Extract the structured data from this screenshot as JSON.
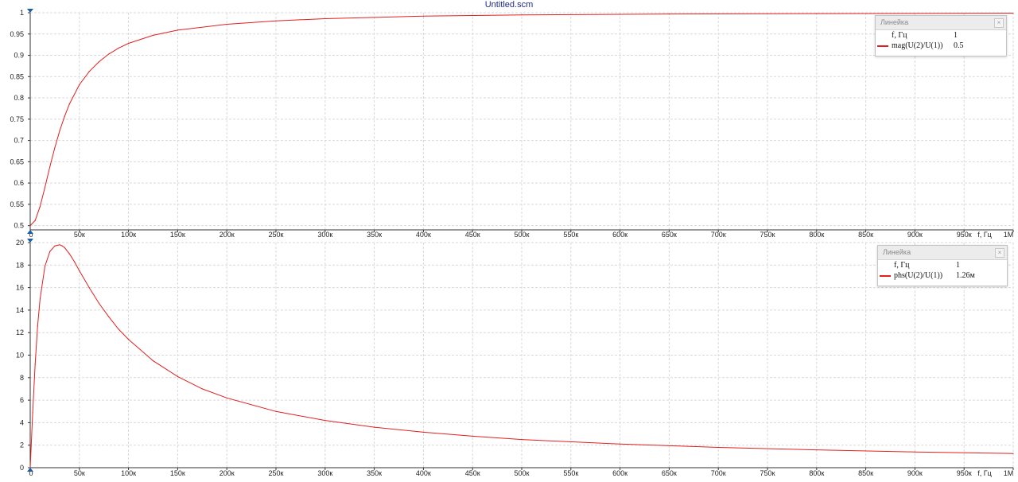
{
  "window": {
    "title": "Untitled.scm"
  },
  "colors": {
    "trace": "#e02020",
    "grid": "#d9d9d9",
    "axis": "#333333",
    "marker": "#1a5ca8"
  },
  "rulers": [
    {
      "title": "Линейка",
      "close": "×",
      "rows": [
        {
          "name": "f, Гц",
          "value": "1",
          "swatch": false
        },
        {
          "name": "mag(U(2)/U(1))",
          "value": "0.5",
          "swatch": true
        }
      ]
    },
    {
      "title": "Линейка",
      "close": "×",
      "rows": [
        {
          "name": "f, Гц",
          "value": "1",
          "swatch": false
        },
        {
          "name": "phs(U(2)/U(1))",
          "value": "1.26м",
          "swatch": true
        }
      ]
    }
  ],
  "chart_data": [
    {
      "type": "line",
      "xlabel": "f, Гц",
      "ylabel": "",
      "xlim": [
        0,
        1000000
      ],
      "ylim": [
        0.49,
        1.0
      ],
      "grid": true,
      "x_ticks": [
        {
          "v": 0,
          "label": "0"
        },
        {
          "v": 50000,
          "label": "50к"
        },
        {
          "v": 100000,
          "label": "100к"
        },
        {
          "v": 150000,
          "label": "150к"
        },
        {
          "v": 200000,
          "label": "200к"
        },
        {
          "v": 250000,
          "label": "250к"
        },
        {
          "v": 300000,
          "label": "300к"
        },
        {
          "v": 350000,
          "label": "350к"
        },
        {
          "v": 400000,
          "label": "400к"
        },
        {
          "v": 450000,
          "label": "450к"
        },
        {
          "v": 500000,
          "label": "500к"
        },
        {
          "v": 550000,
          "label": "550к"
        },
        {
          "v": 600000,
          "label": "600к"
        },
        {
          "v": 650000,
          "label": "650к"
        },
        {
          "v": 700000,
          "label": "700к"
        },
        {
          "v": 750000,
          "label": "750к"
        },
        {
          "v": 800000,
          "label": "800к"
        },
        {
          "v": 850000,
          "label": "850к"
        },
        {
          "v": 900000,
          "label": "900к"
        },
        {
          "v": 950000,
          "label": "950к"
        },
        {
          "v": 1000000,
          "label": "1М"
        }
      ],
      "y_ticks": [
        {
          "v": 0.5,
          "label": "0.5"
        },
        {
          "v": 0.55,
          "label": "0.55"
        },
        {
          "v": 0.6,
          "label": "0.6"
        },
        {
          "v": 0.65,
          "label": "0.65"
        },
        {
          "v": 0.7,
          "label": "0.7"
        },
        {
          "v": 0.75,
          "label": "0.75"
        },
        {
          "v": 0.8,
          "label": "0.8"
        },
        {
          "v": 0.85,
          "label": "0.85"
        },
        {
          "v": 0.9,
          "label": "0.9"
        },
        {
          "v": 0.95,
          "label": "0.95"
        },
        {
          "v": 1.0,
          "label": "1"
        }
      ],
      "series": [
        {
          "name": "mag(U(2)/U(1))",
          "color": "#e02020",
          "x": [
            0,
            5000,
            10000,
            15000,
            20000,
            25000,
            30000,
            35000,
            40000,
            50000,
            60000,
            70000,
            80000,
            90000,
            100000,
            125000,
            150000,
            200000,
            250000,
            300000,
            400000,
            500000,
            650000,
            800000,
            1000000
          ],
          "y": [
            0.5,
            0.512,
            0.545,
            0.59,
            0.638,
            0.683,
            0.723,
            0.757,
            0.786,
            0.831,
            0.862,
            0.885,
            0.903,
            0.917,
            0.928,
            0.947,
            0.959,
            0.973,
            0.981,
            0.986,
            0.992,
            0.995,
            0.997,
            0.998,
            0.999
          ]
        }
      ]
    },
    {
      "type": "line",
      "xlabel": "f, Гц",
      "ylabel": "",
      "xlim": [
        0,
        1000000
      ],
      "ylim": [
        0,
        20
      ],
      "grid": true,
      "x_ticks": [
        {
          "v": 0,
          "label": "0"
        },
        {
          "v": 50000,
          "label": "50к"
        },
        {
          "v": 100000,
          "label": "100к"
        },
        {
          "v": 150000,
          "label": "150к"
        },
        {
          "v": 200000,
          "label": "200к"
        },
        {
          "v": 250000,
          "label": "250к"
        },
        {
          "v": 300000,
          "label": "300к"
        },
        {
          "v": 350000,
          "label": "350к"
        },
        {
          "v": 400000,
          "label": "400к"
        },
        {
          "v": 450000,
          "label": "450к"
        },
        {
          "v": 500000,
          "label": "500к"
        },
        {
          "v": 550000,
          "label": "550к"
        },
        {
          "v": 600000,
          "label": "600к"
        },
        {
          "v": 650000,
          "label": "650к"
        },
        {
          "v": 700000,
          "label": "700к"
        },
        {
          "v": 750000,
          "label": "750к"
        },
        {
          "v": 800000,
          "label": "800к"
        },
        {
          "v": 850000,
          "label": "850к"
        },
        {
          "v": 900000,
          "label": "900к"
        },
        {
          "v": 950000,
          "label": "950к"
        },
        {
          "v": 1000000,
          "label": "1М"
        }
      ],
      "y_ticks": [
        {
          "v": 0,
          "label": "0"
        },
        {
          "v": 2,
          "label": "2"
        },
        {
          "v": 4,
          "label": "4"
        },
        {
          "v": 6,
          "label": "6"
        },
        {
          "v": 8,
          "label": "8"
        },
        {
          "v": 10,
          "label": "10"
        },
        {
          "v": 12,
          "label": "12"
        },
        {
          "v": 14,
          "label": "14"
        },
        {
          "v": 16,
          "label": "16"
        },
        {
          "v": 18,
          "label": "18"
        },
        {
          "v": 20,
          "label": "20"
        }
      ],
      "series": [
        {
          "name": "phs(U(2)/U(1))",
          "color": "#e02020",
          "x": [
            0,
            2500,
            5000,
            7500,
            10000,
            15000,
            20000,
            25000,
            30000,
            32500,
            35000,
            40000,
            45000,
            50000,
            60000,
            70000,
            80000,
            90000,
            100000,
            125000,
            150000,
            175000,
            200000,
            250000,
            300000,
            350000,
            400000,
            450000,
            500000,
            600000,
            700000,
            800000,
            900000,
            1000000
          ],
          "y": [
            0,
            4.9,
            9.2,
            12.6,
            15.0,
            17.9,
            19.2,
            19.7,
            19.8,
            19.7,
            19.55,
            19.0,
            18.3,
            17.5,
            16.0,
            14.6,
            13.4,
            12.3,
            11.4,
            9.5,
            8.1,
            7.0,
            6.2,
            5.0,
            4.2,
            3.6,
            3.15,
            2.8,
            2.5,
            2.1,
            1.8,
            1.58,
            1.4,
            1.26
          ]
        }
      ]
    }
  ]
}
